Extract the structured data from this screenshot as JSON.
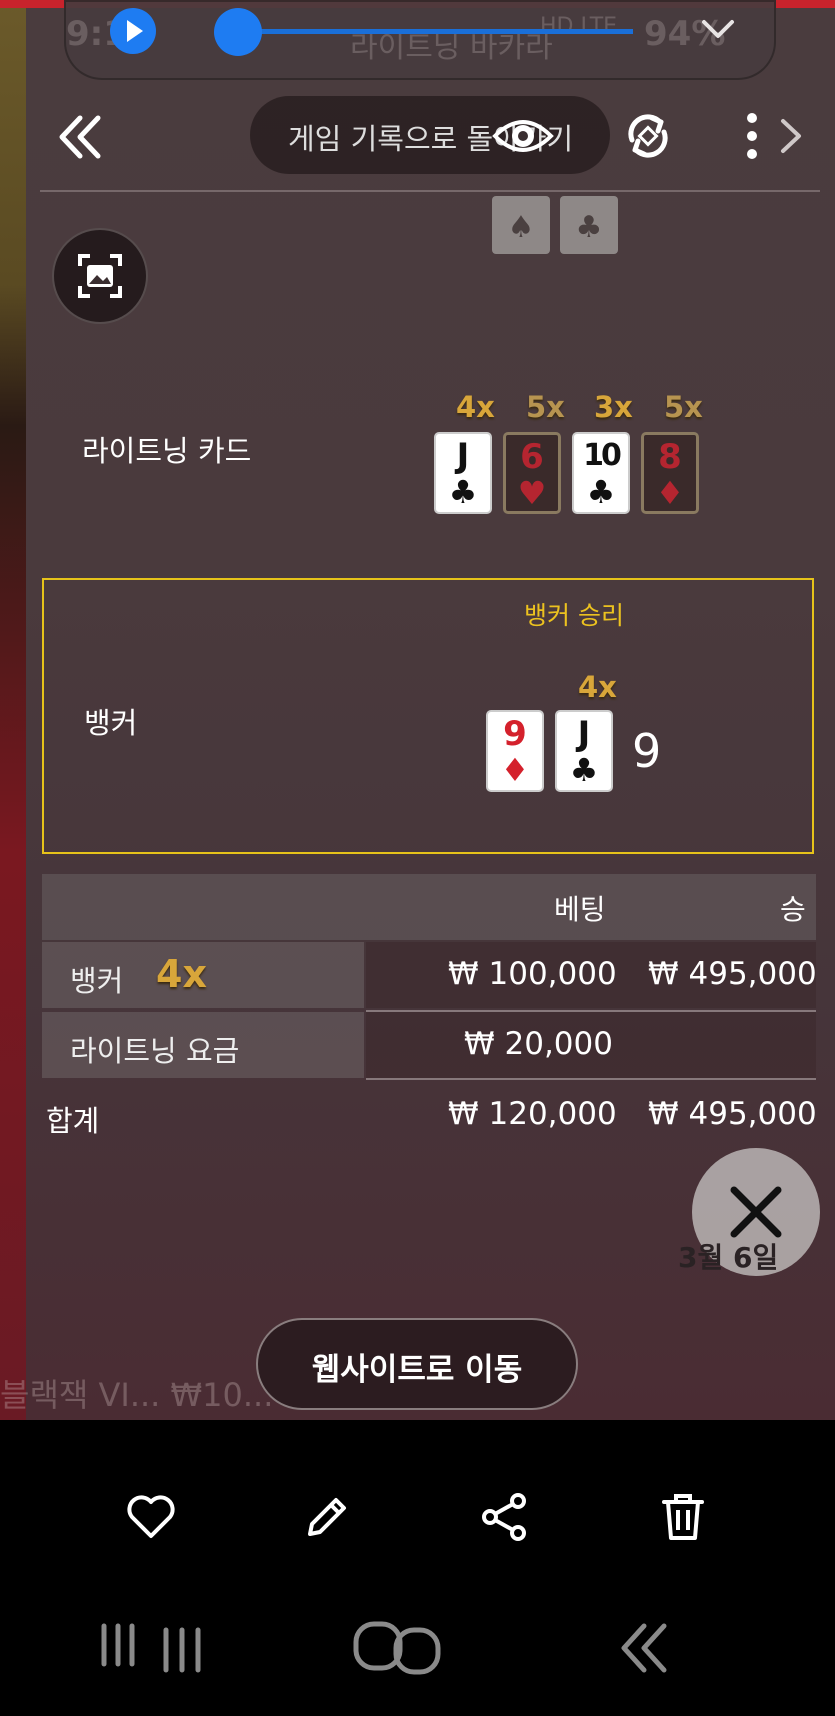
{
  "status_overlay": {
    "time_ghost": "9:1",
    "network_ghost": "HD LTE",
    "battery_ghost": "94%",
    "title_ghost": "라이트닝 바카라"
  },
  "header": {
    "return_label": "게임 기록으로 돌아가기"
  },
  "lightning_cards": {
    "label": "라이트닝 카드",
    "cards": [
      {
        "rank": "J",
        "suit": "♣",
        "color": "black",
        "multiplier": "4x",
        "active": true
      },
      {
        "rank": "6",
        "suit": "♥",
        "color": "red",
        "multiplier": "5x",
        "active": false
      },
      {
        "rank": "10",
        "suit": "♣",
        "color": "black",
        "multiplier": "3x",
        "active": true
      },
      {
        "rank": "8",
        "suit": "♦",
        "color": "red",
        "multiplier": "5x",
        "active": false
      }
    ]
  },
  "banker": {
    "label": "뱅커",
    "result": "뱅커 승리",
    "multiplier": "4x",
    "cards": [
      {
        "rank": "9",
        "suit": "♦",
        "color": "red"
      },
      {
        "rank": "J",
        "suit": "♣",
        "color": "black"
      }
    ],
    "score": "9",
    "border_color": "#e6c31a"
  },
  "bet_table": {
    "headers": {
      "bet": "베팅",
      "win": "승"
    },
    "rows": [
      {
        "name": "뱅커",
        "multiplier": "4x",
        "bet": "₩ 100,000",
        "win": "₩ 495,000"
      },
      {
        "name": "라이트닝 요금",
        "multiplier": "",
        "bet": "₩ 20,000",
        "win": ""
      }
    ],
    "total": {
      "name": "합계",
      "bet": "₩ 120,000",
      "win": "₩ 495,000"
    }
  },
  "date_label": "3월 6일",
  "website_button": "웹사이트로 이동",
  "ghost_bottom": "블랙잭 VI...   ₩10...",
  "toolbar": {
    "icons": [
      "heart-icon",
      "pencil-icon",
      "share-icon",
      "trash-icon"
    ]
  },
  "navbar": {
    "icons": [
      "recent-apps-icon",
      "home-icon",
      "back-icon"
    ]
  },
  "colors": {
    "accent_blue": "#1e7cf2",
    "gold": "#d8a63a",
    "win_yellow": "#ecc21f"
  }
}
